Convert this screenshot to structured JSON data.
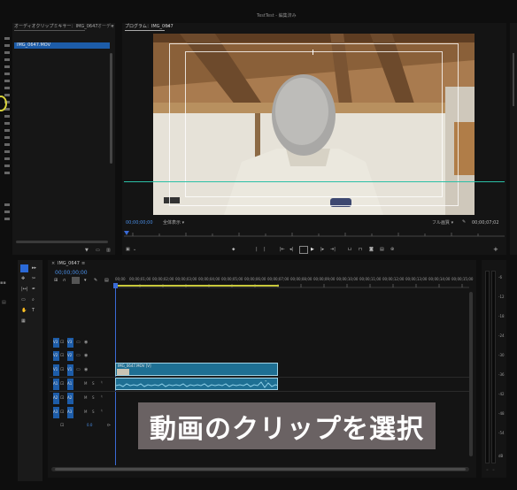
{
  "title": "TestTest - 編集済み",
  "source_panel": {
    "tabs": [
      "オーディオクリップミキサー：IMG_0647",
      "オーディ"
    ],
    "tab_more": "»",
    "clip_name": "IMG_0647.MOV"
  },
  "program": {
    "tab_label": "プログラム：IMG_0647",
    "tab_menu": "≡",
    "timecode_left": "00;00;00;00",
    "zoom": "全体表示",
    "resolution": "フル画質",
    "timecode_right": "00;00;07;02"
  },
  "timeline": {
    "tab_label": "IMG_0647",
    "timecode": "00;00;00;00",
    "ruler_labels": [
      "00;00",
      "00;00;01;00",
      "00;00;02;00",
      "00;00;03;00",
      "00;00;04;00",
      "00;00;05;00",
      "00;00;06;00",
      "00;00;07;00",
      "00;00;08;00",
      "00;00;09;00",
      "00;00;10;00",
      "00;00;11;00",
      "00;00;12;00",
      "00;00;13;00",
      "00;00;14;00",
      "00;00;15;00"
    ],
    "video_tracks": [
      {
        "src": "V3",
        "name": "V3"
      },
      {
        "src": "V2",
        "name": "V2"
      },
      {
        "src": "V1",
        "name": "V1"
      }
    ],
    "audio_tracks": [
      {
        "src": "A1",
        "name": "A1"
      },
      {
        "src": "A2",
        "name": "A2"
      },
      {
        "src": "A3",
        "name": "A3"
      }
    ],
    "track_mute": "M",
    "track_solo": "S",
    "clip_label": "IMG_0647.MOV [V]",
    "master_label": "0.0"
  },
  "caption": "動画のクリップを選択",
  "meter_labels": [
    "-6",
    "-12",
    "-18",
    "-24",
    "-30",
    "-36",
    "-42",
    "-48",
    "-54",
    "dB"
  ],
  "colors": {
    "accent": "#2b6ad8",
    "clip": "#1e6f93",
    "playhead": "#3a6bd6"
  }
}
